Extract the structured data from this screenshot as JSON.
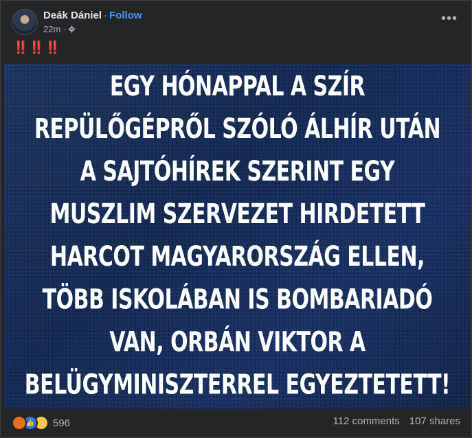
{
  "post": {
    "author": "Deák Dániel",
    "separator": "·",
    "follow_label": "Follow",
    "time": "22m",
    "more_icon": "ellipsis-icon",
    "text": "‼️‼️‼️",
    "image_text": "EGY HÓNAPPAL A SZÍR REPÜLŐGÉPRŐL SZÓLÓ ÁLHÍR UTÁN A SAJTÓHÍREK SZERINT EGY MUSZLIM SZERVEZET HIRDETETT HARCOT MAGYARORSZÁG ELLEN, TÖBB ISKOLÁBAN IS BOMBARIADÓ VAN, ORBÁN VIKTOR A BELÜGYMINISZTERREL EGYEZTETETT!"
  },
  "footer": {
    "reaction_count": "596",
    "comments": "112 comments",
    "shares": "107 shares"
  },
  "colors": {
    "background": "#242526",
    "follow": "#4599ff",
    "image_bg": "#1a3166"
  }
}
